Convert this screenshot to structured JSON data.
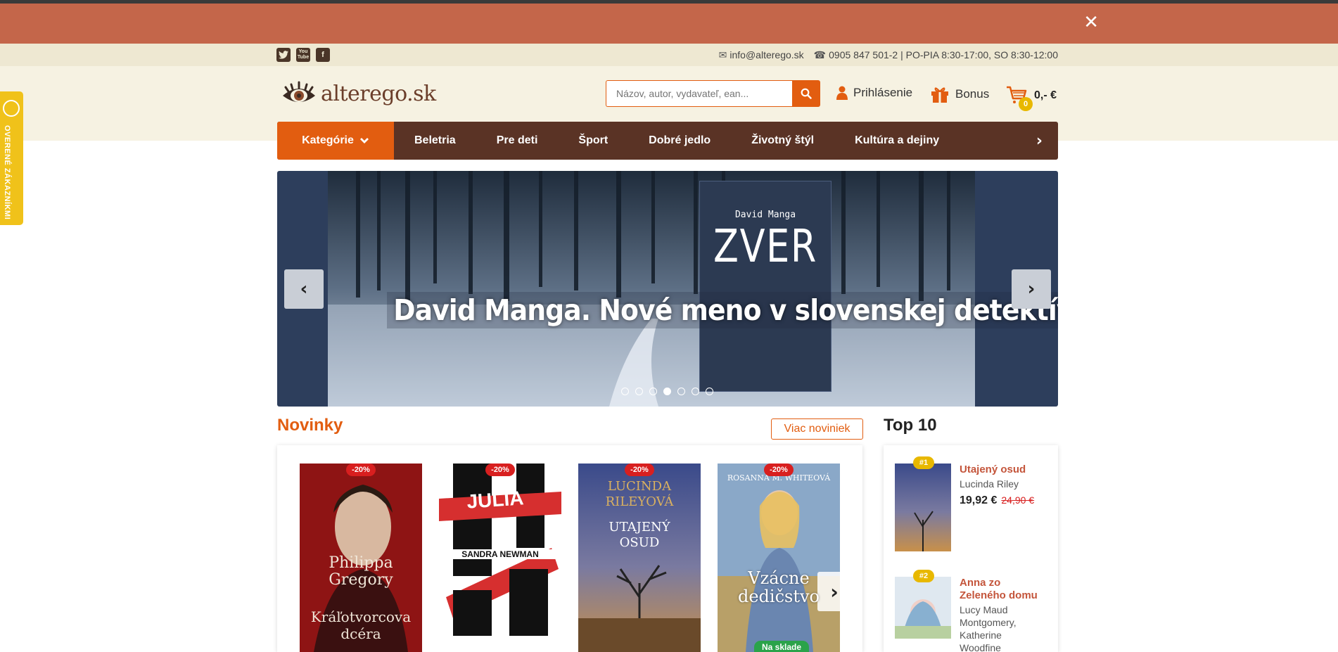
{
  "promo": {
    "close_icon": "✕"
  },
  "social": {
    "twitter": "t",
    "youtube": "You Tube",
    "facebook": "f"
  },
  "contact": {
    "email": "info@alterego.sk",
    "phone": "0905 847 501-2 | PO-PIA 8:30-17:00, SO 8:30-12:00"
  },
  "header": {
    "logo_text": "alterego.sk",
    "search_placeholder": "Názov, autor, vydavateľ, ean...",
    "login_label": "Prihlásenie",
    "bonus_label": "Bonus",
    "cart_count": "0",
    "cart_total": "0,- €"
  },
  "nav": {
    "categories_label": "Kategórie",
    "items": [
      "Beletria",
      "Pre deti",
      "Šport",
      "Dobré jedlo",
      "Životný štýl",
      "Kultúra a dejiny"
    ]
  },
  "side_badge": {
    "label": "OVERENÉ ZÁKAZNÍKMI"
  },
  "hero": {
    "headline": "David Manga. Nové meno v slovenskej detektívke",
    "book_author": "David Manga",
    "book_title": "ZVER",
    "active_dot": 4,
    "dot_count": 7
  },
  "novinky": {
    "title": "Novinky",
    "more_label": "Viac noviniek",
    "books": [
      {
        "discount": "-20%",
        "cover_title": "Kráľotvorcova dcéra",
        "cover_author": "Philippa Gregory",
        "stock": ""
      },
      {
        "discount": "-20%",
        "cover_title": "JULIA",
        "cover_author": "SANDRA NEWMAN",
        "stock": ""
      },
      {
        "discount": "-20%",
        "cover_title": "UTAJENÝ OSUD",
        "cover_author": "LUCINDA RILEYOVÁ",
        "stock": ""
      },
      {
        "discount": "-20%",
        "cover_title": "Vzácne dedičstvo",
        "cover_author": "ROSANNA M. WHITEOVÁ",
        "stock": "Na sklade"
      }
    ]
  },
  "top10": {
    "title": "Top 10",
    "items": [
      {
        "rank": "#1",
        "title": "Utajený osud",
        "author": "Lucinda Riley",
        "price": "19,92 €",
        "old_price": "24,90 €"
      },
      {
        "rank": "#2",
        "title": "Anna zo Zeleného domu",
        "author": "Lucy Maud Montgomery, Katherine Woodfine",
        "price": "",
        "old_price": ""
      }
    ]
  },
  "colors": {
    "promo_bg": "#c4664a",
    "accent": "#e25d10",
    "nav_bg": "#5a3325",
    "discount": "#d81f1f",
    "stock": "#2aa34a",
    "rank": "#e8b800"
  }
}
